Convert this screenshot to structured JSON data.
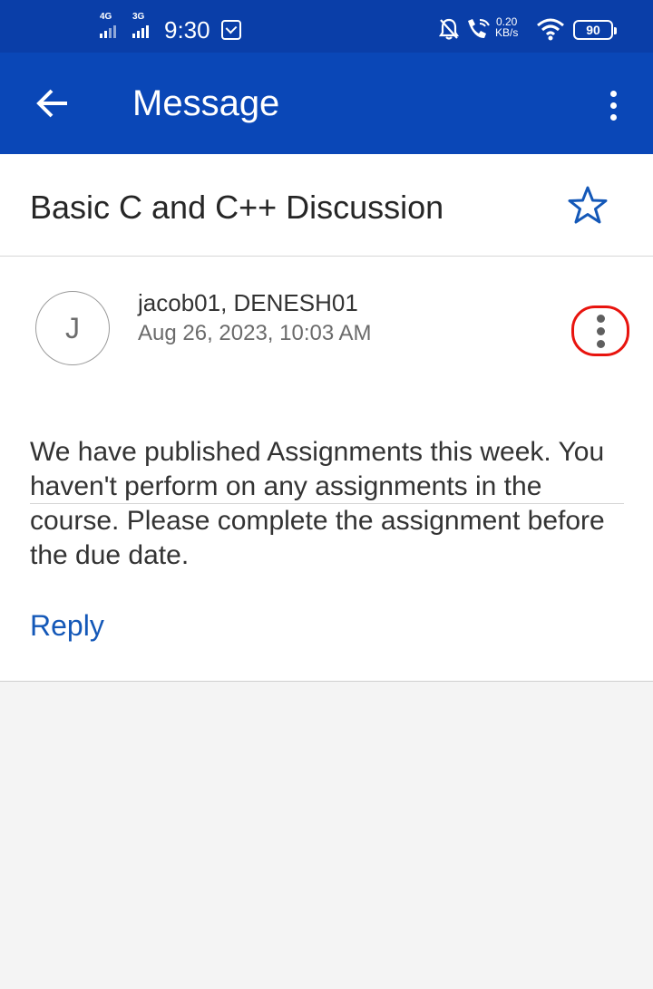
{
  "status_bar": {
    "network_1": "4G",
    "network_2": "3G",
    "time": "9:30",
    "speed_value": "0.20",
    "speed_unit": "KB/s",
    "battery": "90",
    "icons": [
      "signal-bars-icon",
      "message-notification-icon",
      "mute-bell-icon",
      "wifi-call-icon",
      "wifi-icon",
      "battery-icon"
    ]
  },
  "app_bar": {
    "title": "Message",
    "back_icon": "arrow-left-icon",
    "menu_icon": "kebab-menu-icon"
  },
  "message": {
    "subject": "Basic C and C++ Discussion",
    "star_icon": "star-outline-icon",
    "avatar_initial": "J",
    "participants": "jacob01, DENESH01",
    "date": "Aug 26, 2023, 10:03 AM",
    "more_icon": "more-vertical-icon",
    "highlight_color": "#e8140e",
    "body": "We have published Assignments this week. You haven't perform on any assignments in the course. Please complete the assignment before the due date.",
    "reply_label": "Reply"
  },
  "colors": {
    "app_bar": "#0a47b7",
    "status_bar": "#0a3ea8",
    "link": "#1458b8",
    "star": "#1458b8",
    "background": "#f4f4f4"
  }
}
